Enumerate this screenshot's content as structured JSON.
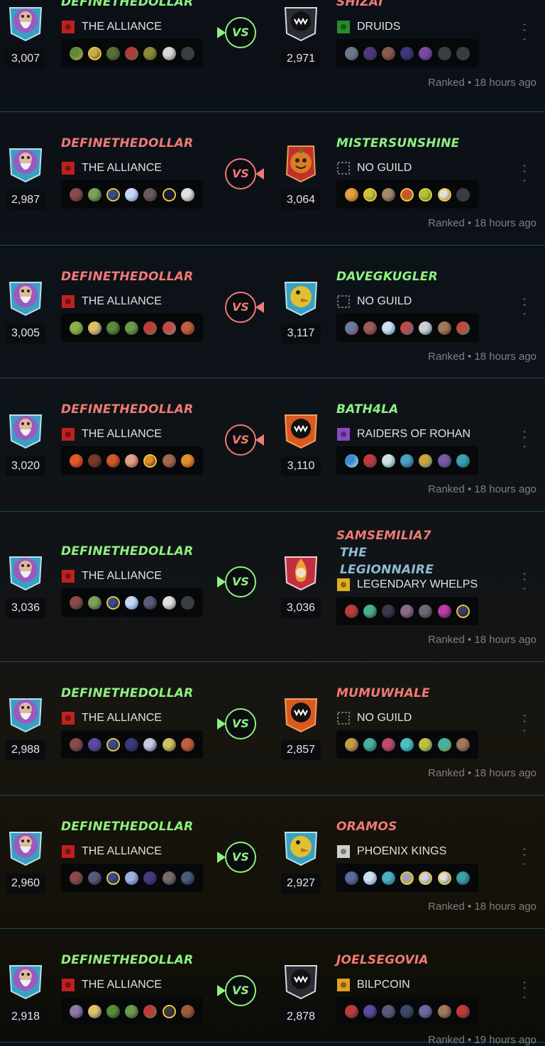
{
  "battles": [
    {
      "left": {
        "name": "DEFINETHEDOLLAR",
        "name_color": "green",
        "guild": "THE ALLIANCE",
        "guild_icon": "alliance-flag-icon",
        "rating": "3,007",
        "avatar": "wizard-avatar",
        "team": [
          [
            "#5f8a3b",
            "#c9a94a",
            false
          ],
          [
            "#c2b04a",
            "#6b3a1e",
            true
          ],
          [
            "#5c6e3a",
            "#2d3d22",
            false
          ],
          [
            "#b23a3a",
            "#3f7a3d",
            false
          ],
          [
            "#8a8a3b",
            "#3b3b22",
            false
          ],
          [
            "#d8d8d8",
            "#555",
            false
          ],
          [
            "empty",
            "",
            false
          ]
        ]
      },
      "right": {
        "name": "SHIZAI",
        "name_color": "red",
        "guild": "DRUIDS",
        "guild_icon": "druids-flag-icon",
        "rating": "2,971",
        "avatar": "monster-avatar",
        "team": [
          [
            "#6a7a8a",
            "#3a4a5a",
            false
          ],
          [
            "#4a3a7a",
            "#2a2a4a",
            false
          ],
          [
            "#8a5a4a",
            "#3a2a2a",
            false
          ],
          [
            "#3a3a7a",
            "#1a1a3a",
            false
          ],
          [
            "#7a4aa0",
            "#3a2a5a",
            false
          ],
          [
            "empty",
            "",
            false
          ],
          [
            "empty",
            "",
            false
          ]
        ]
      },
      "vs_winner": "left",
      "ranked": "Ranked • 18 hours ago"
    },
    {
      "left": {
        "name": "DEFINETHEDOLLAR",
        "name_color": "red",
        "guild": "THE ALLIANCE",
        "guild_icon": "alliance-flag-icon",
        "rating": "2,987",
        "avatar": "wizard-avatar",
        "team": [
          [
            "#8a4a4a",
            "#2a2a2a",
            false
          ],
          [
            "#7aa05a",
            "#2a3a2a",
            false
          ],
          [
            "#3a4a8a",
            "#1a1a3a",
            true
          ],
          [
            "#c8d8f0",
            "#3a6aa0",
            false
          ],
          [
            "#6a5a5a",
            "#2a2a2a",
            false
          ],
          [
            "#1a1a3a",
            "#0a0a1a",
            true
          ],
          [
            "#e0e0e0",
            "#555",
            false
          ]
        ]
      },
      "right": {
        "name": "MISTERSUNSHINE",
        "name_color": "green",
        "guild": "NO GUILD",
        "guild_icon": "no-guild-icon",
        "rating": "3,064",
        "avatar": "pumpkin-avatar",
        "team": [
          [
            "#e0a040",
            "#7a4a1a",
            false
          ],
          [
            "#c8c040",
            "#5a6a1a",
            true
          ],
          [
            "#a08a6a",
            "#3a2a1a",
            false
          ],
          [
            "#d05030",
            "#7a8a1a",
            true
          ],
          [
            "#b0c040",
            "#4a6a1a",
            true
          ],
          [
            "#e0e0e0",
            "#8a6a2a",
            true
          ],
          [
            "empty",
            "",
            false
          ]
        ]
      },
      "vs_winner": "right",
      "ranked": "Ranked • 18 hours ago"
    },
    {
      "left": {
        "name": "DEFINETHEDOLLAR",
        "name_color": "red",
        "guild": "THE ALLIANCE",
        "guild_icon": "alliance-flag-icon",
        "rating": "3,005",
        "avatar": "wizard-avatar",
        "team": [
          [
            "#8ab04a",
            "#3a5a2a",
            false
          ],
          [
            "#e0c060",
            "#3a4a7a",
            false
          ],
          [
            "#5a8a3a",
            "#1a2a1a",
            false
          ],
          [
            "#6a9a4a",
            "#2a3a2a",
            false
          ],
          [
            "#c03a3a",
            "#4a8a3a",
            false
          ],
          [
            "#c04a4a",
            "#8a8a8a",
            false
          ],
          [
            "#c0603a",
            "#5a2a1a",
            false
          ]
        ]
      },
      "right": {
        "name": "DAVEGKUGLER",
        "name_color": "green",
        "guild": "NO GUILD",
        "guild_icon": "no-guild-icon",
        "rating": "3,117",
        "avatar": "yellow-creature-avatar",
        "team": [
          [
            "#6a7aa0",
            "#8a3a3a",
            false
          ],
          [
            "#a05a5a",
            "#3a2a2a",
            false
          ],
          [
            "#d0e0f0",
            "#2a6a8a",
            false
          ],
          [
            "#c04a4a",
            "#3a6a8a",
            false
          ],
          [
            "#d0d0d0",
            "#2a5a7a",
            false
          ],
          [
            "#a07a5a",
            "#3a2a2a",
            false
          ],
          [
            "#c04a3a",
            "#2a8a9a",
            false
          ]
        ]
      },
      "vs_winner": "right",
      "ranked": "Ranked • 18 hours ago"
    },
    {
      "left": {
        "name": "DEFINETHEDOLLAR",
        "name_color": "red",
        "guild": "THE ALLIANCE",
        "guild_icon": "alliance-flag-icon",
        "rating": "3,020",
        "avatar": "wizard-avatar",
        "team": [
          [
            "#e05a2a",
            "#7a1a1a",
            false
          ],
          [
            "#7a3a2a",
            "#2a1a1a",
            false
          ],
          [
            "#d05a2a",
            "#4a1a1a",
            false
          ],
          [
            "#e0a08a",
            "#7a2a2a",
            false
          ],
          [
            "#e08a2a",
            "#3a1a1a",
            true
          ],
          [
            "#a06a4a",
            "#4a2a2a",
            false
          ],
          [
            "#e0902a",
            "#6a2a1a",
            false
          ]
        ]
      },
      "right": {
        "name": "BATH4LA",
        "name_color": "green",
        "guild": "RAIDERS OF ROHAN",
        "guild_icon": "raiders-flag-icon",
        "rating": "3,110",
        "avatar": "orange-monster-avatar",
        "team": [
          [
            "#3a8ad0",
            "#d0e0f0",
            false
          ],
          [
            "#c03a3a",
            "#3a3a5a",
            false
          ],
          [
            "#d0e0e0",
            "#2a6a8a",
            false
          ],
          [
            "#4aa0c0",
            "#1a3a5a",
            false
          ],
          [
            "#d0a03a",
            "#2a7a8a",
            false
          ],
          [
            "#7a5aa0",
            "#2a3a5a",
            false
          ],
          [
            "#3aa0b0",
            "#1a4a5a",
            false
          ]
        ]
      },
      "vs_winner": "right",
      "ranked": "Ranked • 18 hours ago"
    },
    {
      "left": {
        "name": "DEFINETHEDOLLAR",
        "name_color": "green",
        "guild": "THE ALLIANCE",
        "guild_icon": "alliance-flag-icon",
        "rating": "3,036",
        "avatar": "wizard-avatar",
        "team": [
          [
            "#8a4a4a",
            "#2a2a2a",
            false
          ],
          [
            "#7aa05a",
            "#2a3a2a",
            false
          ],
          [
            "#3a4a8a",
            "#1a1a3a",
            true
          ],
          [
            "#c8d8f0",
            "#3a6aa0",
            false
          ],
          [
            "#5a5a7a",
            "#1a1a2a",
            false
          ],
          [
            "#e0e0e0",
            "#555",
            false
          ],
          [
            "empty",
            "",
            false
          ]
        ]
      },
      "right": {
        "name": "SAMSEMILIA7",
        "name2": "THE LEGIONNAIRE",
        "name_color": "red",
        "guild": "LEGENDARY WHELPS",
        "guild_icon": "whelps-flag-icon",
        "rating": "3,036",
        "avatar": "flame-avatar",
        "team": [
          [
            "#c03a3a",
            "#3a2a2a",
            false
          ],
          [
            "#4ab08a",
            "#1a3a3a",
            false
          ],
          [
            "#3a3a4a",
            "#0a0a1a",
            false
          ],
          [
            "#8a6a8a",
            "#2a2a3a",
            false
          ],
          [
            "#6a6a7a",
            "#2a2a2a",
            false
          ],
          [
            "#c03aa0",
            "#2a1a3a",
            false
          ],
          [
            "#3a3a6a",
            "#1a1a2a",
            true
          ]
        ]
      },
      "vs_winner": "left",
      "ranked": "Ranked • 18 hours ago"
    },
    {
      "left": {
        "name": "DEFINETHEDOLLAR",
        "name_color": "green",
        "guild": "THE ALLIANCE",
        "guild_icon": "alliance-flag-icon",
        "rating": "2,988",
        "avatar": "wizard-avatar",
        "team": [
          [
            "#8a4a4a",
            "#2a2a2a",
            false
          ],
          [
            "#5a4aa0",
            "#2a2a4a",
            false
          ],
          [
            "#3a4a8a",
            "#1a1a3a",
            true
          ],
          [
            "#3a3a7a",
            "#1a1a3a",
            false
          ],
          [
            "#c8c8e0",
            "#2a2a5a",
            false
          ],
          [
            "#d0c060",
            "#3a3a2a",
            false
          ],
          [
            "#c0603a",
            "#5a2a1a",
            false
          ]
        ]
      },
      "right": {
        "name": "MUMUWHALE",
        "name_color": "red",
        "guild": "NO GUILD",
        "guild_icon": "no-guild-icon",
        "rating": "2,857",
        "avatar": "orange-monster-avatar",
        "team": [
          [
            "#c0a03a",
            "#5a2a6a",
            false
          ],
          [
            "#4ab0a0",
            "#1a3a3a",
            false
          ],
          [
            "#c04a6a",
            "#3a2a3a",
            false
          ],
          [
            "#4ac0c0",
            "#1a5a6a",
            false
          ],
          [
            "#c0c040",
            "#2a6a5a",
            false
          ],
          [
            "#4ab0a0",
            "#7a8a3a",
            false
          ],
          [
            "#a07a5a",
            "#3a2a2a",
            false
          ]
        ]
      },
      "vs_winner": "left",
      "ranked": "Ranked • 18 hours ago"
    },
    {
      "left": {
        "name": "DEFINETHEDOLLAR",
        "name_color": "green",
        "guild": "THE ALLIANCE",
        "guild_icon": "alliance-flag-icon",
        "rating": "2,960",
        "avatar": "wizard-avatar",
        "team": [
          [
            "#8a4a4a",
            "#2a2a2a",
            false
          ],
          [
            "#5a5a7a",
            "#1a1a2a",
            false
          ],
          [
            "#3a4a8a",
            "#1a1a3a",
            true
          ],
          [
            "#a0b0e0",
            "#3a4a8a",
            false
          ],
          [
            "#4a3a7a",
            "#1a1a3a",
            false
          ],
          [
            "#7a6a6a",
            "#2a2a2a",
            false
          ],
          [
            "#4a5a7a",
            "#1a1a2a",
            false
          ]
        ]
      },
      "right": {
        "name": "ORAMOS",
        "name_color": "red",
        "guild": "PHOENIX KINGS",
        "guild_icon": "phoenix-flag-icon",
        "rating": "2,927",
        "avatar": "yellow-creature-avatar",
        "team": [
          [
            "#5a6a9a",
            "#2a2a3a",
            false
          ],
          [
            "#d0e0f0",
            "#4a7a9a",
            false
          ],
          [
            "#4ab0c0",
            "#2a4a5a",
            false
          ],
          [
            "#a0a0c0",
            "#c0a030",
            true
          ],
          [
            "#d0d0e0",
            "#4a8aa0",
            true
          ],
          [
            "#e0e0e0",
            "#2a6a8a",
            true
          ],
          [
            "#3aa0a0",
            "#1a3a4a",
            false
          ]
        ]
      },
      "vs_winner": "left",
      "ranked": "Ranked • 18 hours ago"
    },
    {
      "left": {
        "name": "DEFINETHEDOLLAR",
        "name_color": "green",
        "guild": "THE ALLIANCE",
        "guild_icon": "alliance-flag-icon",
        "rating": "2,918",
        "avatar": "wizard-avatar",
        "team": [
          [
            "#8a7aa0",
            "#3a2a4a",
            false
          ],
          [
            "#e0c060",
            "#3a4a7a",
            false
          ],
          [
            "#5a8a3a",
            "#1a2a1a",
            false
          ],
          [
            "#6a9a4a",
            "#2a3a2a",
            false
          ],
          [
            "#c03a3a",
            "#4a8a3a",
            false
          ],
          [
            "#3a3a3a",
            "#1a1a1a",
            true
          ],
          [
            "#a05a3a",
            "#3a2a1a",
            false
          ]
        ]
      },
      "right": {
        "name": "JOELSEGOVIA",
        "name_color": "red",
        "guild": "BILPCOIN",
        "guild_icon": "bilpcoin-flag-icon",
        "rating": "2,878",
        "avatar": "monster-avatar",
        "team": [
          [
            "#c03a3a",
            "#3a2a2a",
            false
          ],
          [
            "#5a4aa0",
            "#1a1a3a",
            false
          ],
          [
            "#5a5a7a",
            "#2a2a3a",
            false
          ],
          [
            "#3a4a6a",
            "#1a1a2a",
            false
          ],
          [
            "#6a6aa0",
            "#2a2a3a",
            false
          ],
          [
            "#a07a5a",
            "#3a2a2a",
            false
          ],
          [
            "#c03a3a",
            "#3a2a2a",
            false
          ]
        ]
      },
      "vs_winner": "left",
      "ranked": "Ranked • 19 hours ago"
    }
  ],
  "vs_label": "VS",
  "colors": {
    "win_green": "#8ef17f",
    "loss_red": "#f07a74",
    "blue_name": "#8fbcd3",
    "divider": "#1f4a57"
  }
}
